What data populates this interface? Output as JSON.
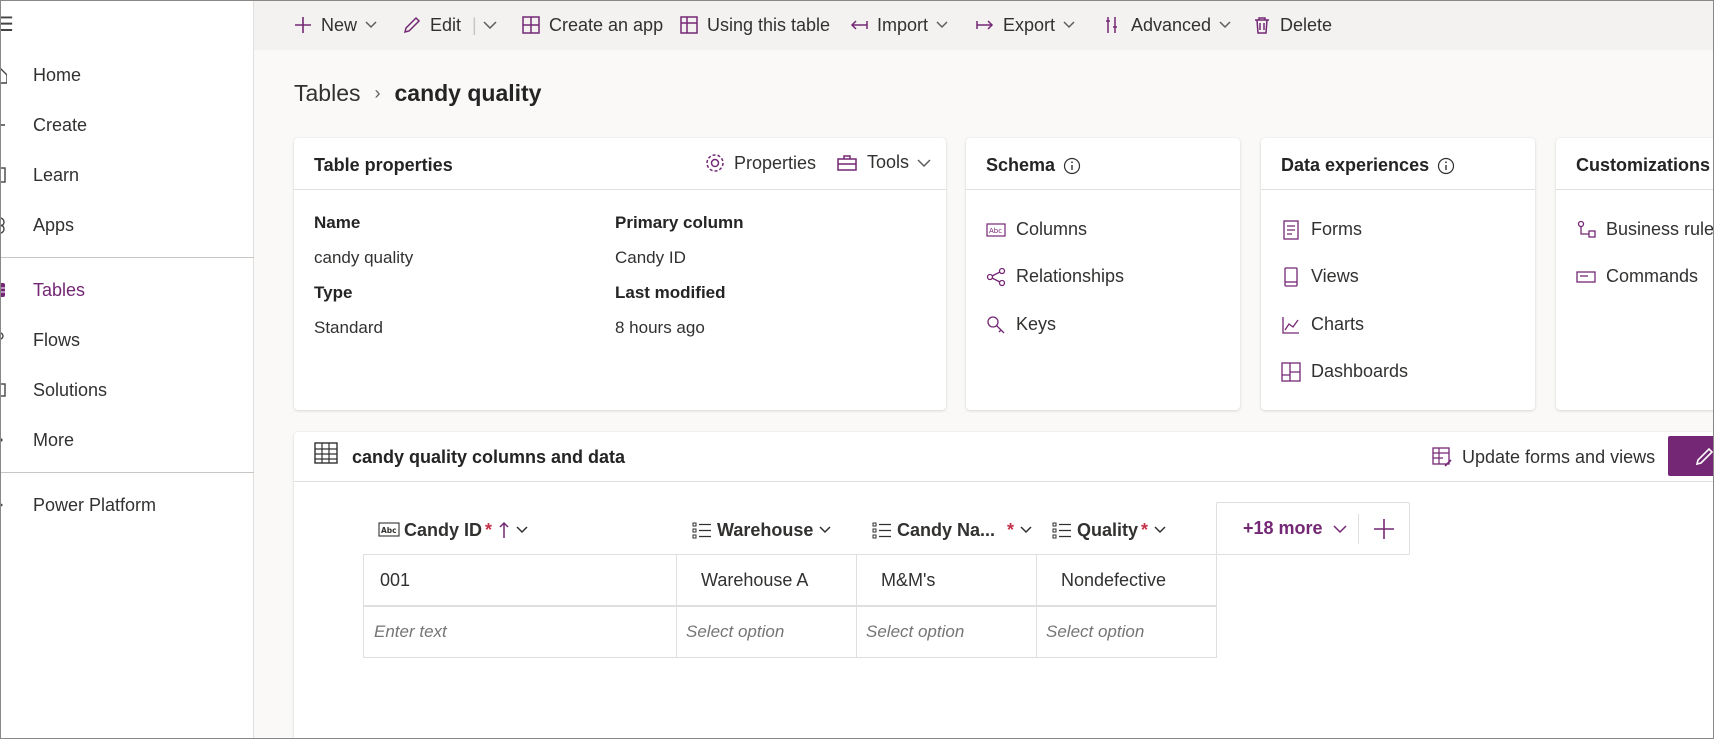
{
  "sidebar": {
    "items": [
      {
        "label": "Home",
        "icon": "home-icon"
      },
      {
        "label": "Create",
        "icon": "plus-icon"
      },
      {
        "label": "Learn",
        "icon": "book-icon"
      },
      {
        "label": "Apps",
        "icon": "apps-icon"
      },
      {
        "label": "Tables",
        "icon": "table-icon"
      },
      {
        "label": "Flows",
        "icon": "flow-icon"
      },
      {
        "label": "Solutions",
        "icon": "solution-icon"
      },
      {
        "label": "More",
        "icon": "more-icon"
      },
      {
        "label": "Power Platform",
        "icon": "power-platform-icon"
      }
    ],
    "active": "Tables"
  },
  "toolbar": {
    "new": "New",
    "edit": "Edit",
    "create_app": "Create an app",
    "using_table": "Using this table",
    "import": "Import",
    "export": "Export",
    "advanced": "Advanced",
    "delete": "Delete"
  },
  "breadcrumb": {
    "root": "Tables",
    "current": "candy quality"
  },
  "table_properties": {
    "title": "Table properties",
    "properties_btn": "Properties",
    "tools_btn": "Tools",
    "name_label": "Name",
    "name_value": "candy quality",
    "primary_label": "Primary column",
    "primary_value": "Candy ID",
    "type_label": "Type",
    "type_value": "Standard",
    "modified_label": "Last modified",
    "modified_value": "8 hours ago"
  },
  "schema": {
    "title": "Schema",
    "items": [
      "Columns",
      "Relationships",
      "Keys"
    ]
  },
  "data_experiences": {
    "title": "Data experiences",
    "items": [
      "Forms",
      "Views",
      "Charts",
      "Dashboards"
    ]
  },
  "customizations": {
    "title": "Customizations",
    "items": [
      "Business rules",
      "Commands"
    ]
  },
  "data_panel": {
    "title": "candy quality columns and data",
    "update_btn": "Update forms and views",
    "columns": [
      {
        "label": "Candy ID",
        "required": "*"
      },
      {
        "label": "Warehouse",
        "required": ""
      },
      {
        "label": "Candy Na...",
        "required": "*"
      },
      {
        "label": "Quality",
        "required": "*"
      }
    ],
    "more_cols": "+18 more",
    "row": [
      "001",
      "Warehouse A",
      "M&M's",
      "Nondefective"
    ],
    "placeholders": [
      "Enter text",
      "Select option",
      "Select option",
      "Select option"
    ]
  },
  "colors": {
    "accent": "#742774",
    "required": "#c4314b"
  }
}
